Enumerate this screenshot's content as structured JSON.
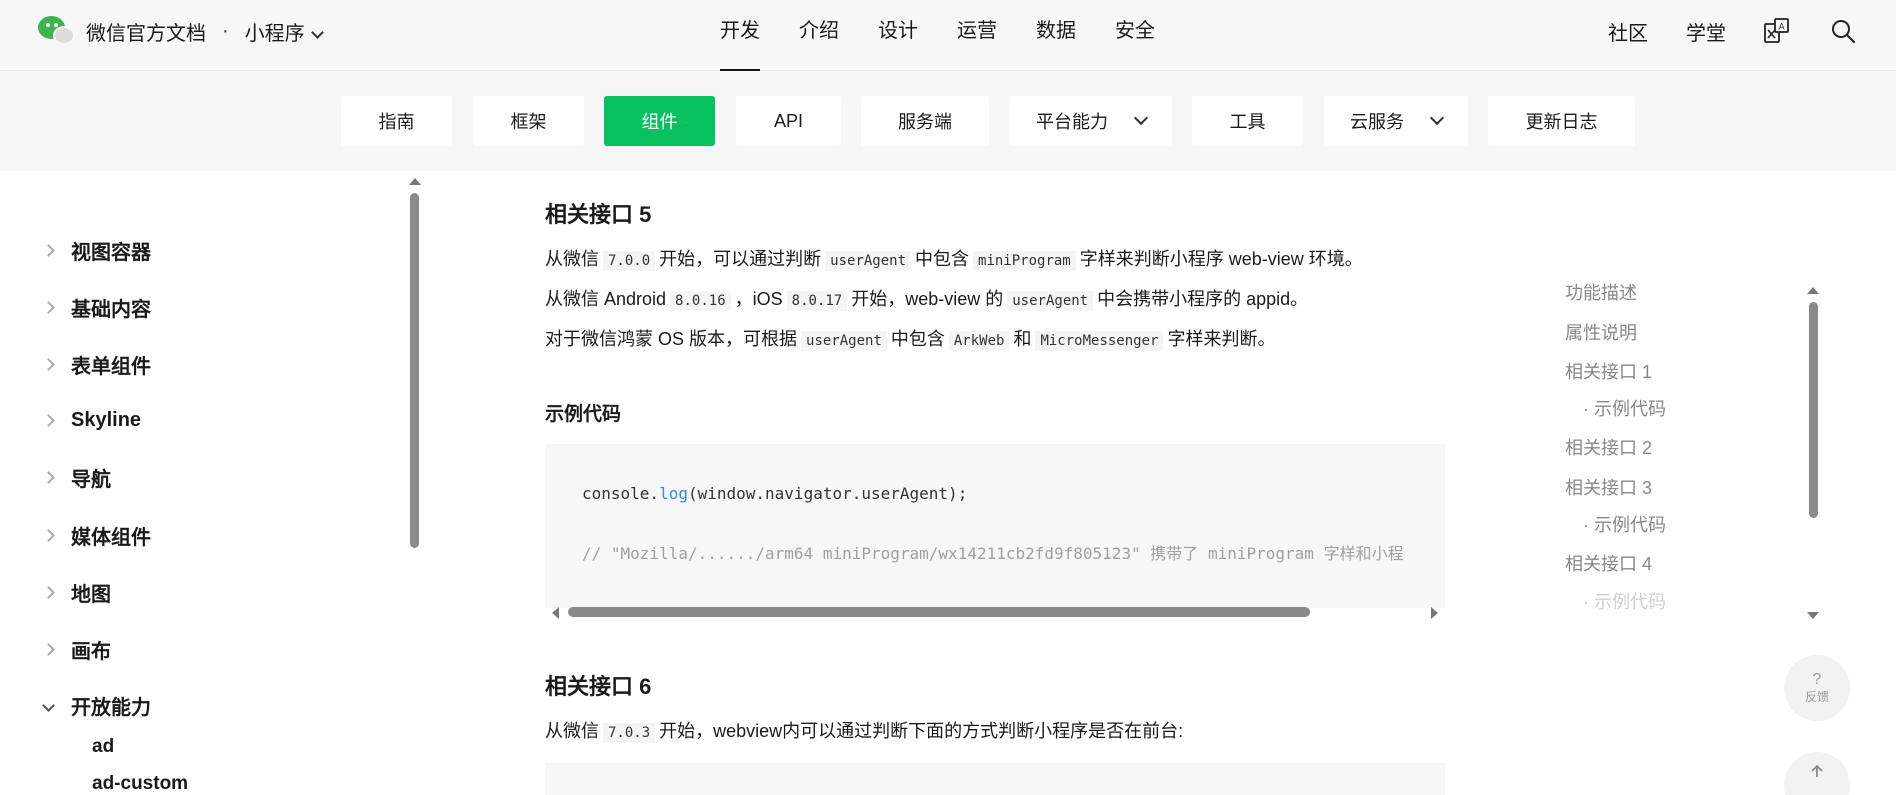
{
  "header": {
    "brand": "微信官方文档",
    "dot": "·",
    "product": "小程序",
    "main_nav": [
      "开发",
      "介绍",
      "设计",
      "运营",
      "数据",
      "安全"
    ],
    "right_nav": [
      "社区",
      "学堂"
    ]
  },
  "subnav": {
    "items": [
      "指南",
      "框架",
      "组件",
      "API",
      "服务端",
      "平台能力",
      "工具",
      "云服务",
      "更新日志"
    ],
    "active": "组件"
  },
  "sidebar": {
    "items": [
      "视图容器",
      "基础内容",
      "表单组件",
      "Skyline",
      "导航",
      "媒体组件",
      "地图",
      "画布",
      "开放能力"
    ],
    "sub_items": [
      "ad",
      "ad-custom"
    ]
  },
  "content": {
    "section5": {
      "title": "相关接口 5",
      "p1": {
        "a": "从微信",
        "c1": "7.0.0",
        "b": "开始，可以通过判断",
        "c2": "userAgent",
        "d": "中包含",
        "c3": "miniProgram",
        "e": "字样来判断小程序 web-view 环境。"
      },
      "p2": {
        "a": "从微信 Android",
        "c1": "8.0.16",
        "b": "，iOS",
        "c2": "8.0.17",
        "d": "开始，web-view 的",
        "c3": "userAgent",
        "e": "中会携带小程序的 appid。"
      },
      "p3": {
        "a": "对于微信鸿蒙 OS 版本，可根据",
        "c1": "userAgent",
        "b": "中包含",
        "c2": "ArkWeb",
        "d": "和",
        "c3": "MicroMessenger",
        "e": "字样来判断。"
      }
    },
    "example_title": "示例代码",
    "code": {
      "l1_a": "console.",
      "l1_fn": "log",
      "l1_b": "(window.navigator.userAgent);",
      "l2": "// \"Mozilla/....../arm64 miniProgram/wx14211cb2fd9f805123\"    携带了 miniProgram 字样和小程"
    },
    "section6": {
      "title": "相关接口 6",
      "p1": {
        "a": "从微信",
        "c1": "7.0.3",
        "b": "开始，webview内可以通过判断下面的方式判断小程序是否在前台:"
      }
    }
  },
  "toc": {
    "items": [
      {
        "label": "功能描述",
        "sub": false
      },
      {
        "label": "属性说明",
        "sub": false
      },
      {
        "label": "相关接口 1",
        "sub": false
      },
      {
        "label": "· 示例代码",
        "sub": true
      },
      {
        "label": "相关接口 2",
        "sub": false
      },
      {
        "label": "相关接口 3",
        "sub": false
      },
      {
        "label": "· 示例代码",
        "sub": true
      },
      {
        "label": "相关接口 4",
        "sub": false
      },
      {
        "label": "· 示例代码",
        "sub": true
      }
    ]
  },
  "float": {
    "feedback_icon": "?",
    "feedback_label": "反馈"
  },
  "colors": {
    "accent": "#07c160",
    "link_blue": "#2d8cf0"
  }
}
